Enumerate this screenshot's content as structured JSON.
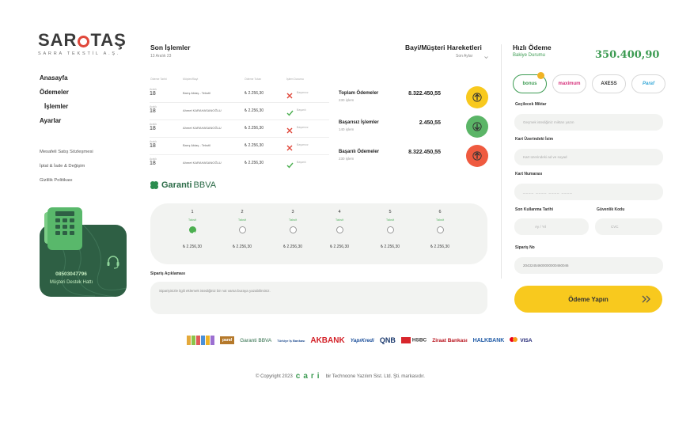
{
  "brand": {
    "name_left": "SAR",
    "name_right": "TAŞ",
    "subtitle": "SARRA TEKSTİL A.Ş."
  },
  "nav": [
    {
      "label": "Anasayfa",
      "sub": false
    },
    {
      "label": "Ödemeler",
      "sub": false
    },
    {
      "label": "İşlemler",
      "sub": true
    },
    {
      "label": "Ayarlar",
      "sub": false
    }
  ],
  "policies": [
    "Mesafeli Satış Sözleşmesi",
    "İptal & İade & Değişim",
    "Gizlilik Politikası"
  ],
  "support": {
    "phone": "08503047796",
    "label": "Müşteri Destek Hattı"
  },
  "last_transactions": {
    "title": "Son İşlemler",
    "date": "13 Aralık 23",
    "headers": [
      "Ödeme Tarihi",
      "Müşteri/Bayi",
      "Ödeme Tutarı",
      "İşlem Durumu"
    ],
    "rows": [
      {
        "month": "Aralık",
        "day": "18",
        "name": "Barış Aktaş - Tekstil",
        "amount": "₺ 2.256,30",
        "status": "fail",
        "status_text": "Başarısız"
      },
      {
        "month": "Aralık",
        "day": "18",
        "name": "Ahmet KARAHASANOĞLU",
        "amount": "₺ 2.256,30",
        "status": "ok",
        "status_text": "Başarılı"
      },
      {
        "month": "Aralık",
        "day": "18",
        "name": "Ahmet KARAHASANOĞLU",
        "amount": "₺ 2.256,30",
        "status": "fail",
        "status_text": "Başarısız"
      },
      {
        "month": "Aralık",
        "day": "18",
        "name": "Barış Aktaş - Tekstil",
        "amount": "₺ 2.256,30",
        "status": "fail",
        "status_text": "Başarısız"
      },
      {
        "month": "Aralık",
        "day": "18",
        "name": "Ahmet KARAHASANOĞLU",
        "amount": "₺ 2.256,30",
        "status": "ok",
        "status_text": "Başarılı"
      }
    ]
  },
  "movements": {
    "title": "Bayi/Müşteri Hareketleri",
    "filter": "Son Aylar",
    "items": [
      {
        "label": "Toplam Ödemeler",
        "sub": "230 işlem",
        "value": "8.322.450,55",
        "color": "#f8c91e",
        "direction": "up"
      },
      {
        "label": "Başarısız İşlemler",
        "sub": "140 işlem",
        "value": "2.450,55",
        "color": "#5bb567",
        "direction": "down"
      },
      {
        "label": "Başarılı Ödemeler",
        "sub": "230 işlem",
        "value": "8.322.450,55",
        "color": "#ef5a3f",
        "direction": "up"
      }
    ]
  },
  "installments": {
    "bank": "Garanti",
    "bank_suffix": "BBVA",
    "unit_label": "Taksit",
    "options": [
      {
        "count": "1",
        "amount": "₺ 2.256,30",
        "selected": true
      },
      {
        "count": "2",
        "amount": "₺ 2.256,30",
        "selected": false
      },
      {
        "count": "3",
        "amount": "₺ 2.256,30",
        "selected": false
      },
      {
        "count": "4",
        "amount": "₺ 2.256,30",
        "selected": false
      },
      {
        "count": "5",
        "amount": "₺ 2.256,30",
        "selected": false
      },
      {
        "count": "6",
        "amount": "₺ 2.256,30",
        "selected": false
      }
    ]
  },
  "order_note": {
    "label": "Sipariş Açıklaması",
    "placeholder": "Siparişinizle ilgili eklemek istediğiniz bir not varsa buraya yazabilirsiniz."
  },
  "quick_payment": {
    "title": "Hızlı Ödeme",
    "balance_label": "Bakiye Durumu",
    "balance": "350.400,90",
    "cards": [
      {
        "name": "bonus",
        "color": "#3c9b52",
        "selected": true
      },
      {
        "name": "maximum",
        "color": "#d6317b",
        "selected": false
      },
      {
        "name": "AXESS",
        "color": "#333333",
        "selected": false
      },
      {
        "name": "Paraf",
        "color": "#39a9d8",
        "selected": false
      }
    ],
    "amount_label": "Geçilecek Miktar",
    "amount_placeholder": "Geçmek istediğiniz miktarı yazın",
    "name_label": "Kart Üzerindeki İsim",
    "name_placeholder": "Kart üzerindeki ad ve soyad",
    "number_label": "Kart Numarası",
    "number_placeholder": "____  ____  ____  ____",
    "expiry_label": "Son Kullanma Tarihi",
    "expiry_placeholder": "Ay / Yıl",
    "cvc_label": "Güvenlik Kodu",
    "cvc_placeholder": "CVC",
    "order_no_label": "Sipariş No",
    "order_no": "20432454600000000460046",
    "pay_button": "Ödeme Yapın"
  },
  "banks": [
    "bankasya",
    "paraf",
    "Garanti BBVA",
    "Türkiye İş Bankası",
    "AKBANK",
    "YapıKredi",
    "QNB",
    "HSBC",
    "Ziraat Bankası",
    "HALKBANK",
    "VISA"
  ],
  "footer": {
    "copyright": "© Copyright 2023",
    "brand": "cari",
    "company": "bir Technoone Yazılım Sist. Ltd. Şti. markasıdır."
  }
}
